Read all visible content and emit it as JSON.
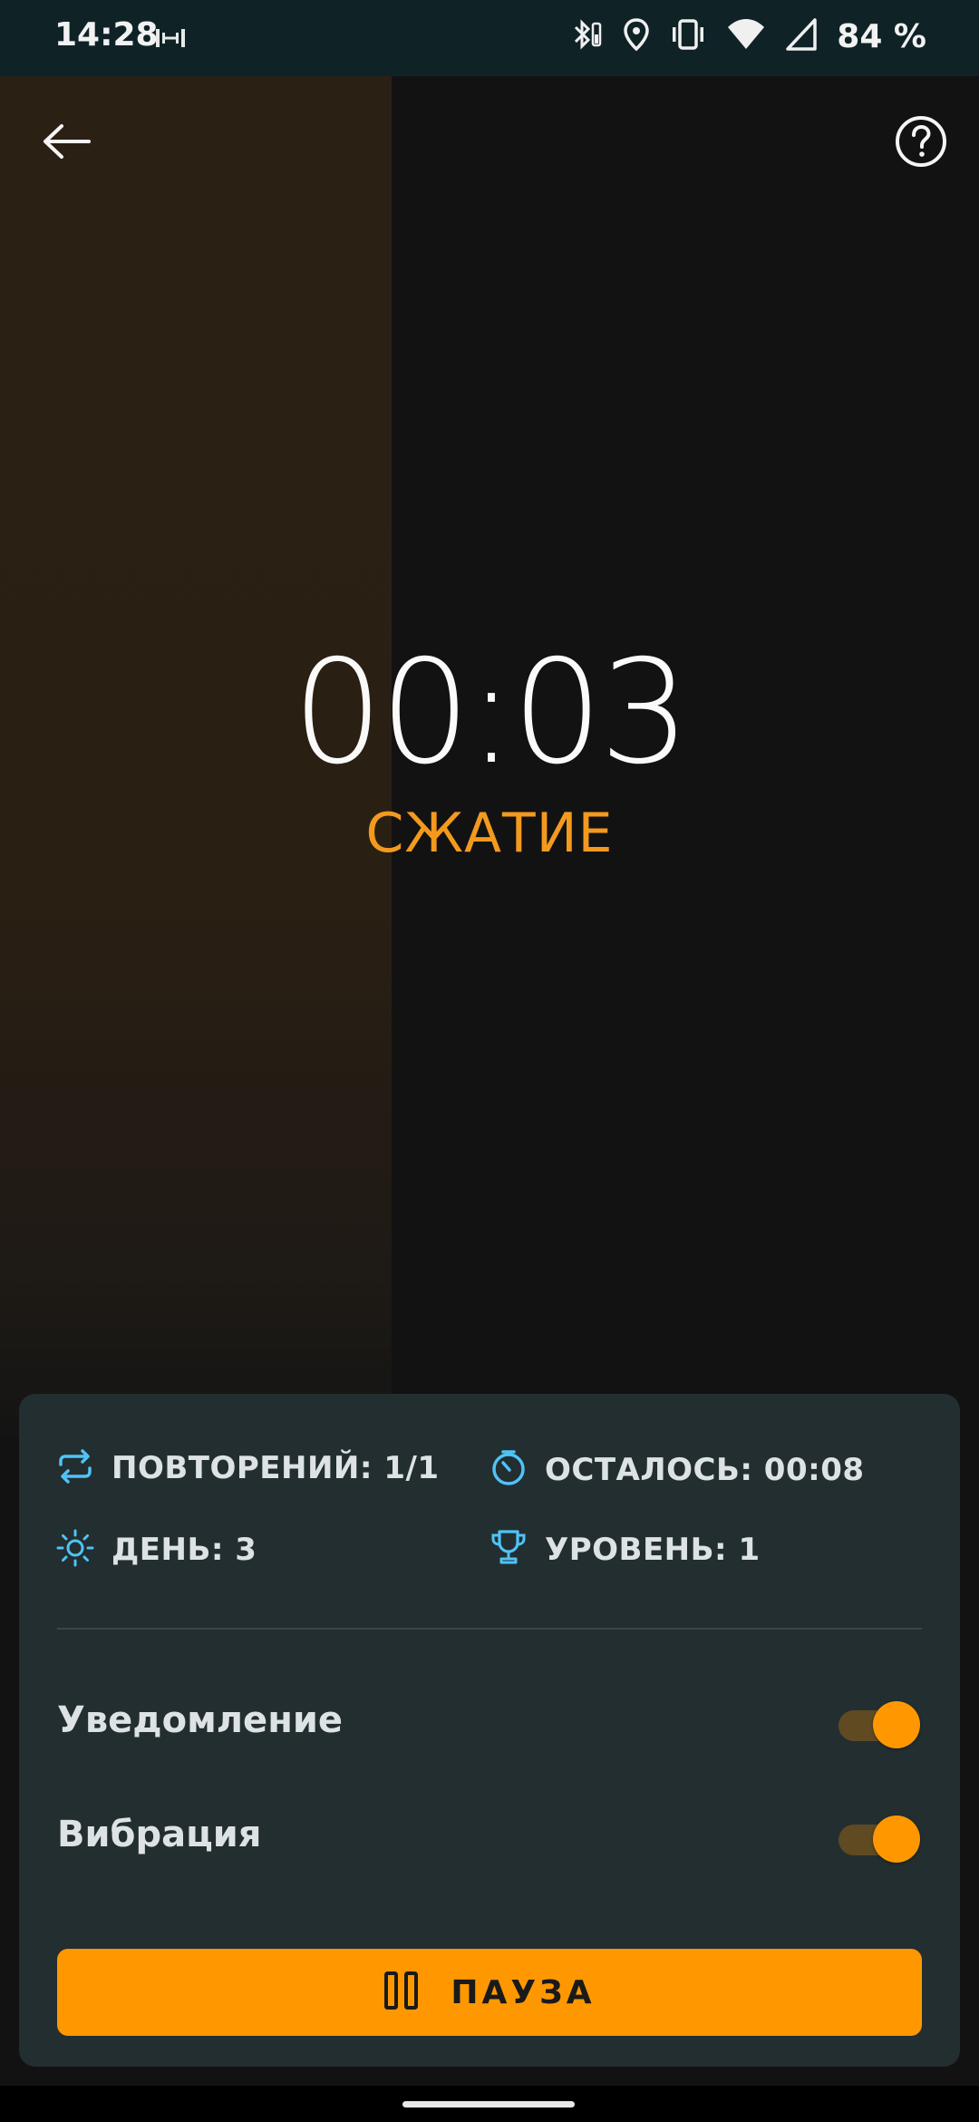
{
  "status_bar": {
    "time": "14:28",
    "battery": "84 %",
    "icons": [
      "dumbbell-icon",
      "bluetooth-icon",
      "location-icon",
      "vibrate-icon",
      "wifi-icon",
      "signal-icon"
    ]
  },
  "header": {
    "back_icon": "arrow-left-icon",
    "help_icon": "help-circle-icon"
  },
  "timer": {
    "value": "00:03",
    "phase": "СЖАТИЕ",
    "progress": 0.4
  },
  "stats": {
    "repetitions": "ПОВТОРЕНИЙ: 1/1",
    "remaining": "ОСТАЛОСЬ: 00:08",
    "day": "ДЕНЬ: 3",
    "level": "УРОВЕНЬ: 1"
  },
  "settings": {
    "notification_label": "Уведомление",
    "notification_on": true,
    "vibration_label": "Вибрация",
    "vibration_on": true
  },
  "action": {
    "pause_label": "ПАУЗА"
  },
  "colors": {
    "accent": "#ff9800",
    "phase_text": "#f39a1e",
    "stat_icon": "#4fc3f7",
    "panel_bg": "#232e30",
    "statusbar_bg": "#0f2327"
  }
}
